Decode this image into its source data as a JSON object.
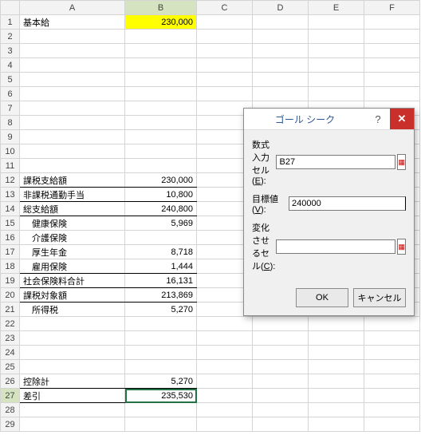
{
  "columns": [
    "A",
    "B",
    "C",
    "D",
    "E",
    "F"
  ],
  "active_col": "B",
  "active_row": 27,
  "rows": [
    {
      "n": 1,
      "A": "基本給",
      "B": "230,000",
      "Bclass": "yellow right"
    },
    {
      "n": 2
    },
    {
      "n": 3
    },
    {
      "n": 4
    },
    {
      "n": 5
    },
    {
      "n": 6
    },
    {
      "n": 7
    },
    {
      "n": 8
    },
    {
      "n": 9
    },
    {
      "n": 10
    },
    {
      "n": 11
    },
    {
      "n": 12,
      "A": "課税支給額",
      "B": "230,000",
      "rowClass": "bold-bottom",
      "Bclass": "right"
    },
    {
      "n": 13,
      "A": "非課税通勤手当",
      "B": "10,800",
      "rowClass": "bold-bottom",
      "Bclass": "right"
    },
    {
      "n": 14,
      "A": "総支給額",
      "B": "240,800",
      "rowClass": "bold-bottom",
      "Bclass": "right"
    },
    {
      "n": 15,
      "A": "　健康保険",
      "B": "5,969",
      "Bclass": "right"
    },
    {
      "n": 16,
      "A": "　介護保険"
    },
    {
      "n": 17,
      "A": "　厚生年金",
      "B": "8,718",
      "Bclass": "right"
    },
    {
      "n": 18,
      "A": "　雇用保険",
      "B": "1,444",
      "rowClass": "bold-bottom",
      "Bclass": "right"
    },
    {
      "n": 19,
      "A": "社会保険料合計",
      "B": "16,131",
      "rowClass": "bold-bottom",
      "Bclass": "right"
    },
    {
      "n": 20,
      "A": "課税対象額",
      "B": "213,869",
      "rowClass": "bold-bottom",
      "Bclass": "right"
    },
    {
      "n": 21,
      "A": "　所得税",
      "B": "5,270",
      "Bclass": "right"
    },
    {
      "n": 22
    },
    {
      "n": 23
    },
    {
      "n": 24
    },
    {
      "n": 25
    },
    {
      "n": 26,
      "A": "控除計",
      "B": "5,270",
      "rowClass": "bold-bottom",
      "Bclass": "right"
    },
    {
      "n": 27,
      "A": "差引",
      "B": "235,530",
      "rowClass": "bold-bottom",
      "Bclass": "right",
      "selB": true
    },
    {
      "n": 28
    },
    {
      "n": 29
    }
  ],
  "dialog": {
    "title": "ゴール シーク",
    "help": "?",
    "close": "✕",
    "labels": {
      "set_cell_pre": "数式入力セル(",
      "set_cell_key": "E",
      "set_cell_post": "):",
      "to_value_pre": "目標値(",
      "to_value_key": "V",
      "to_value_post": "):",
      "by_cell_pre": "変化させるセル(",
      "by_cell_key": "C",
      "by_cell_post": "):"
    },
    "values": {
      "set_cell": "B27",
      "to_value": "240000",
      "by_cell": ""
    },
    "buttons": {
      "ok": "OK",
      "cancel": "キャンセル"
    }
  }
}
